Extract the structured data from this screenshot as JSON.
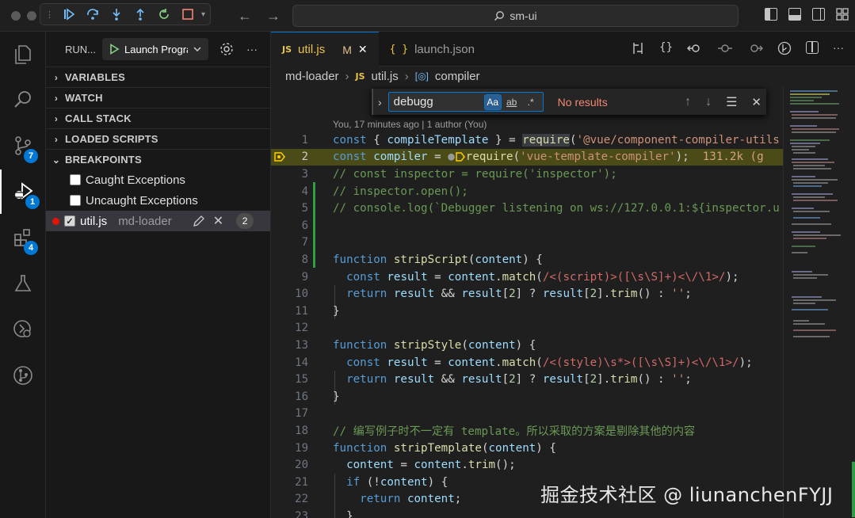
{
  "window": {
    "title": "sm-ui"
  },
  "debug_toolbar": {
    "icons": [
      "continue-icon",
      "step-over-icon",
      "step-into-icon",
      "step-out-icon",
      "restart-icon",
      "stop-icon"
    ]
  },
  "activity_bar": {
    "badges": {
      "source_control": "7",
      "run_debug": "1",
      "extensions": "4"
    }
  },
  "sidebar": {
    "title": "RUN...",
    "launch_config": "Launch Program",
    "sections": {
      "variables": "VARIABLES",
      "watch": "WATCH",
      "call_stack": "CALL STACK",
      "loaded_scripts": "LOADED SCRIPTS",
      "breakpoints": "BREAKPOINTS"
    },
    "breakpoints": {
      "caught": "Caught Exceptions",
      "uncaught": "Uncaught Exceptions",
      "file": "util.js",
      "folder": "md-loader",
      "count": "2"
    }
  },
  "tabs": [
    {
      "icon": "JS",
      "label": "util.js",
      "modified": "M"
    },
    {
      "icon": "{ }",
      "label": "launch.json"
    }
  ],
  "breadcrumb": {
    "folder": "md-loader",
    "file_icon": "JS",
    "file": "util.js",
    "symbol": "compiler"
  },
  "find_widget": {
    "query": "debugg",
    "match_case": "Aa",
    "whole_word": "ab",
    "regex": ".*",
    "status": "No results"
  },
  "blame": "You, 17 minutes ago | 1 author (You)",
  "code": {
    "lines": [
      "1",
      "2",
      "3",
      "4",
      "5",
      "6",
      "7",
      "8",
      "9",
      "10",
      "11",
      "12",
      "13",
      "14",
      "15",
      "16",
      "17",
      "18",
      "19",
      "20",
      "21",
      "22",
      "23"
    ],
    "inline_value": "131.2k (g",
    "comment_line_18": "// 编写例子时不一定有 template。所以采取的方案是剔除其他的内容"
  },
  "watermark": "掘金技术社区 @ liunanchenFYJJ",
  "colors": {
    "accent": "#0078d4",
    "breakpoint": "#e51400",
    "debug_line": "#4b4b18",
    "no_results": "#f48771"
  }
}
